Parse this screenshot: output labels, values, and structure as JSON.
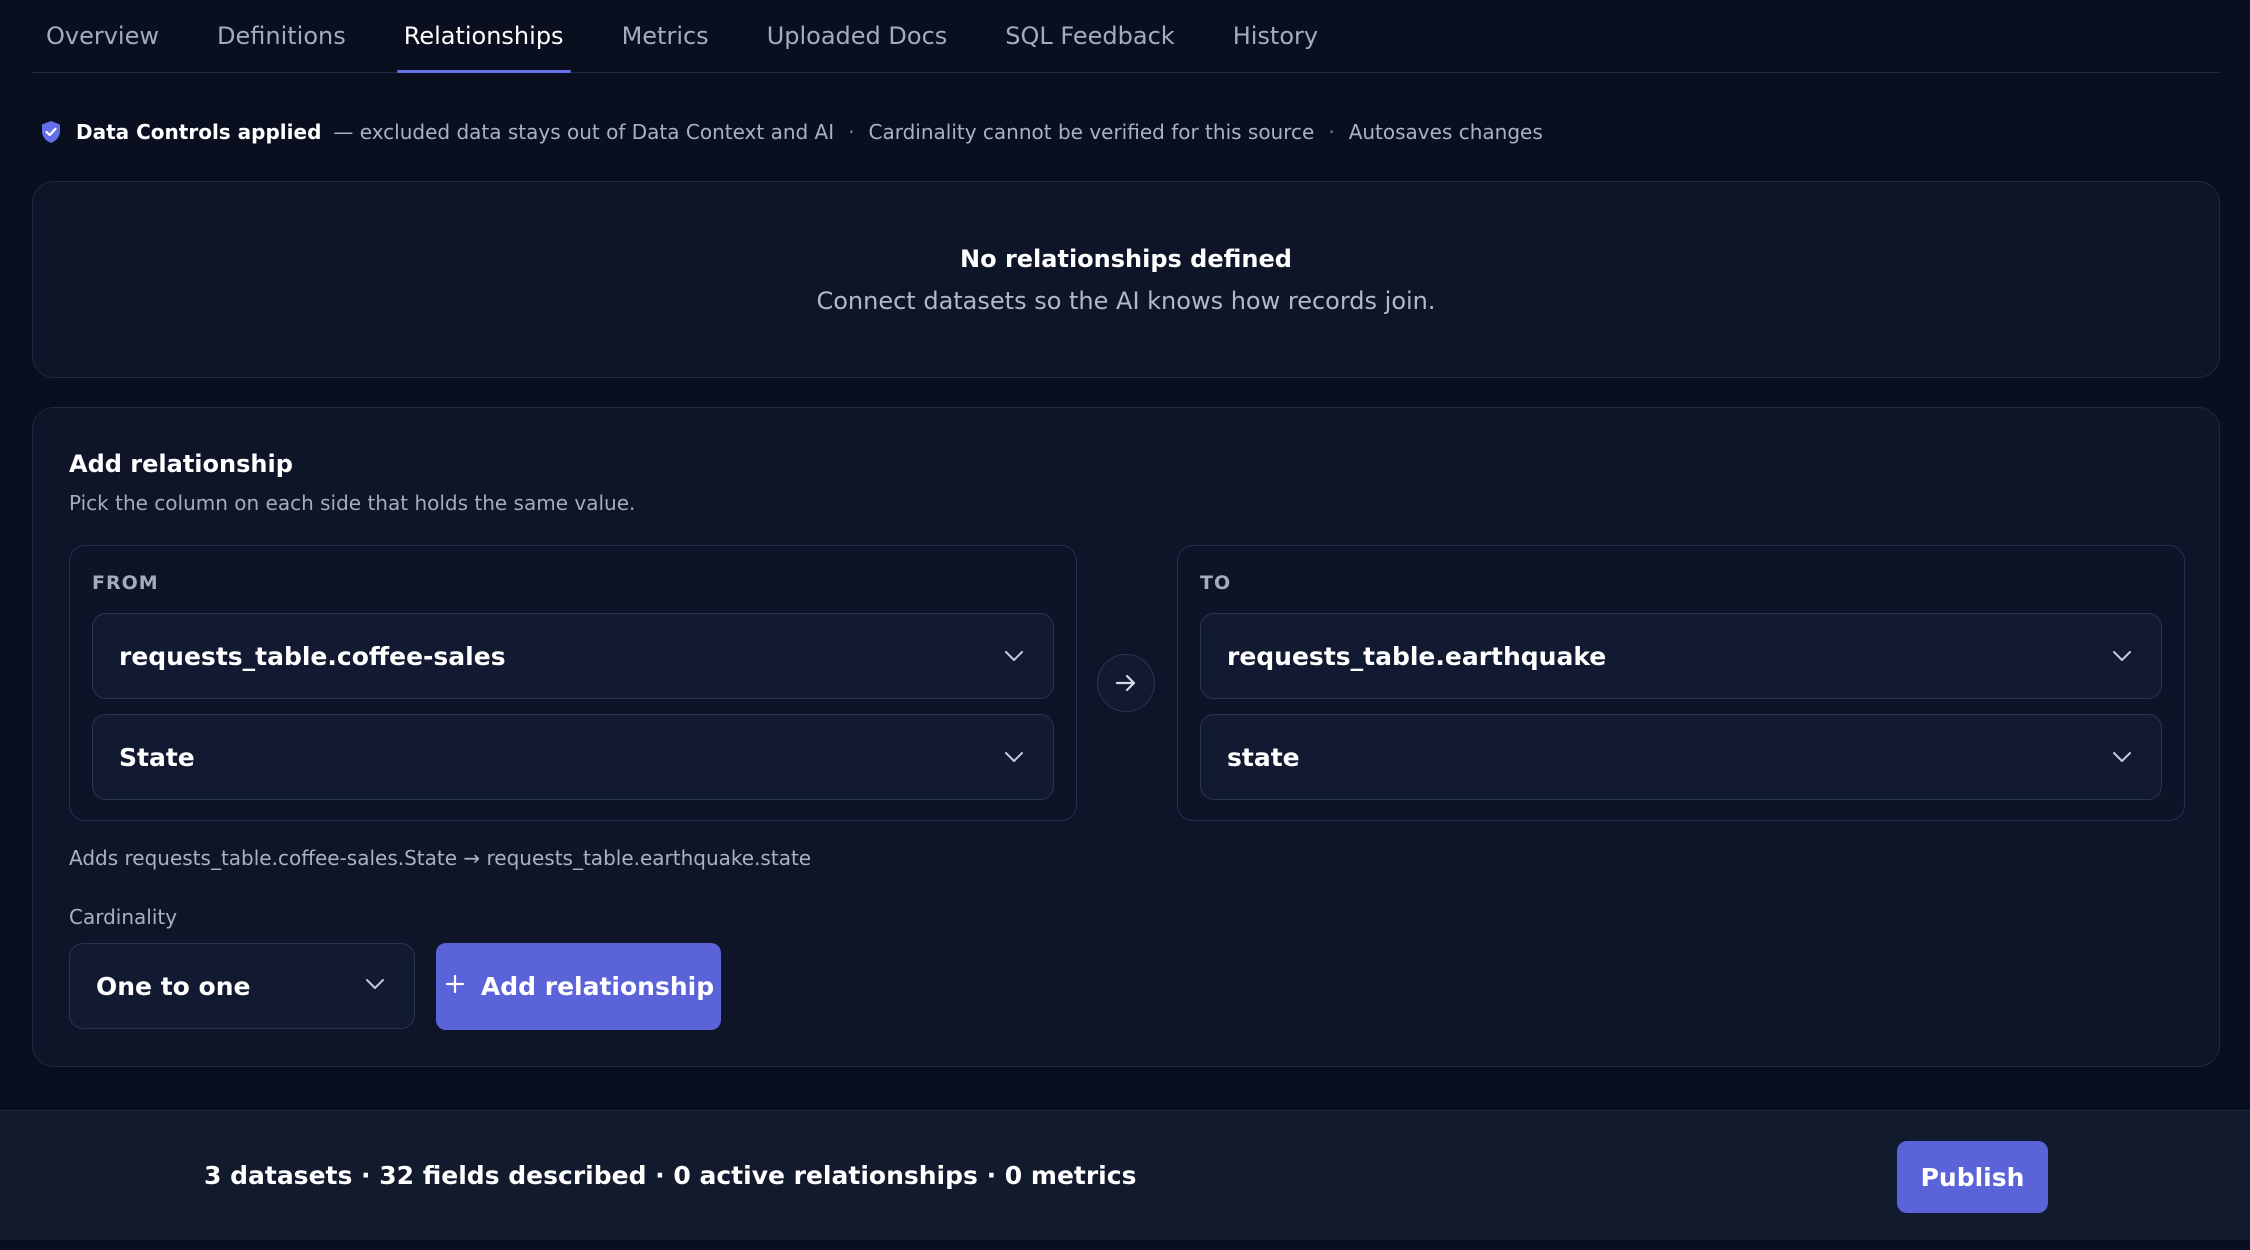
{
  "tabs": [
    {
      "label": "Overview",
      "active": false
    },
    {
      "label": "Definitions",
      "active": false
    },
    {
      "label": "Relationships",
      "active": true
    },
    {
      "label": "Metrics",
      "active": false
    },
    {
      "label": "Uploaded Docs",
      "active": false
    },
    {
      "label": "SQL Feedback",
      "active": false
    },
    {
      "label": "History",
      "active": false
    }
  ],
  "notice": {
    "icon": "shield-check-icon",
    "title": "Data Controls applied",
    "detail": "— excluded data stays out of Data Context and AI",
    "separator": "·",
    "cardinality_note": "Cardinality cannot be verified for this source",
    "autosave": "Autosaves changes"
  },
  "empty_state": {
    "title": "No relationships defined",
    "subtitle": "Connect datasets so the AI knows how records join."
  },
  "add_relationship": {
    "title": "Add relationship",
    "subtitle": "Pick the column on each side that holds the same value.",
    "from": {
      "label": "FROM",
      "table": "requests_table.coffee-sales",
      "column": "State"
    },
    "to": {
      "label": "TO",
      "table": "requests_table.earthquake",
      "column": "state"
    },
    "summary": "Adds requests_table.coffee-sales.State → requests_table.earthquake.state",
    "cardinality_label": "Cardinality",
    "cardinality_value": "One to one",
    "add_button": "Add relationship"
  },
  "footer": {
    "stats": "3 datasets · 32 fields described · 0 active relationships · 0 metrics",
    "publish": "Publish"
  },
  "colors": {
    "accent": "#5b63d8",
    "background": "#0a0f1f",
    "card": "#0e1529"
  }
}
